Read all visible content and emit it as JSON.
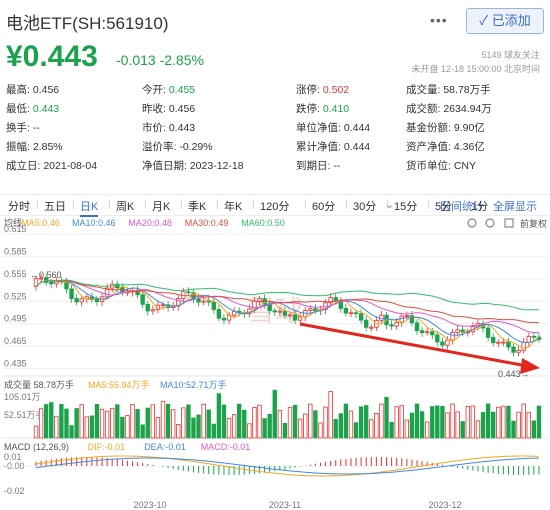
{
  "header": {
    "title": "电池ETF(SH:561910)",
    "more": "•••",
    "add_label": "✓ 已添加"
  },
  "quote": {
    "price": "¥0.443",
    "change": "-0.013",
    "change_pct": "-2.85%",
    "followers": "5149 球友关注",
    "status": "未开盘 12-18 15:00:00 北京时间"
  },
  "stats": [
    [
      {
        "label": "最高:",
        "value": "0.456",
        "tone": ""
      },
      {
        "label": "今开:",
        "value": "0.455",
        "tone": "down"
      },
      {
        "label": "涨停:",
        "value": "0.502",
        "tone": "up"
      },
      {
        "label": "成交量:",
        "value": "58.78万手",
        "tone": ""
      }
    ],
    [
      {
        "label": "最低:",
        "value": "0.443",
        "tone": "down"
      },
      {
        "label": "昨收:",
        "value": "0.456",
        "tone": ""
      },
      {
        "label": "跌停:",
        "value": "0.410",
        "tone": "down"
      },
      {
        "label": "成交额:",
        "value": "2634.94万",
        "tone": ""
      }
    ],
    [
      {
        "label": "换手:",
        "value": "--",
        "tone": ""
      },
      {
        "label": "市价:",
        "value": "0.443",
        "tone": ""
      },
      {
        "label": "单位净值:",
        "value": "0.444",
        "tone": ""
      },
      {
        "label": "基金份额:",
        "value": "9.90亿",
        "tone": ""
      }
    ],
    [
      {
        "label": "振幅:",
        "value": "2.85%",
        "tone": ""
      },
      {
        "label": "溢价率:",
        "value": "-0.29%",
        "tone": ""
      },
      {
        "label": "累计净值:",
        "value": "0.444",
        "tone": ""
      },
      {
        "label": "资产净值:",
        "value": "4.36亿",
        "tone": ""
      }
    ],
    [
      {
        "label": "成立日:",
        "value": "2021-08-04",
        "tone": ""
      },
      {
        "label": "净值日期:",
        "value": "2023-12-18",
        "tone": ""
      },
      {
        "label": "到期日:",
        "value": "--",
        "tone": ""
      },
      {
        "label": "货币单位:",
        "value": "CNY",
        "tone": ""
      }
    ]
  ],
  "tabs": [
    "分时",
    "五日",
    "日K",
    "周K",
    "月K",
    "季K",
    "年K",
    "120分",
    "60分",
    "30分",
    "15分",
    "5分",
    "1分"
  ],
  "active_tab": "日K",
  "chevron": "⌄",
  "links": {
    "stats": "区间统计",
    "fullscreen": "全屏显示"
  },
  "chart": {
    "legend": [
      {
        "text": "均线",
        "color": "#555555"
      },
      {
        "text": "MA5:0.46",
        "color": "#f5a623"
      },
      {
        "text": "MA10:0.46",
        "color": "#3d8be0"
      },
      {
        "text": "MA20:0.48",
        "color": "#e056c8"
      },
      {
        "text": "MA30:0.49",
        "color": "#e04c3f"
      },
      {
        "text": "MA60:0.50",
        "color": "#2fbf6a"
      }
    ],
    "icons": [
      "gear-icon",
      "settings-icon",
      "expand-icon"
    ],
    "fq": "前复权",
    "y_ticks": [
      "0.615",
      "0.585",
      "0.555",
      "0.525",
      "0.495",
      "0.465",
      "0.435"
    ],
    "high_label": "0.560",
    "last_label": "0.443",
    "vol_legend": [
      {
        "text": "成交量 58.78万手",
        "color": "#555555"
      },
      {
        "text": "MA5:55.94万手",
        "color": "#f5a623"
      },
      {
        "text": "MA10:52.71万手",
        "color": "#3d8be0"
      }
    ],
    "vol_ticks": [
      "105.01万",
      "52.51万手"
    ],
    "macd_legend": [
      {
        "text": "MACD (12,26,9)",
        "color": "#555555"
      },
      {
        "text": "DIF:-0.01",
        "color": "#f5a623"
      },
      {
        "text": "DEA:-0.01",
        "color": "#3d8be0"
      },
      {
        "text": "MACD:-0.01",
        "color": "#e056c8"
      }
    ],
    "macd_ticks": [
      "0.01",
      "-0.00",
      "-0.02"
    ],
    "x_labels": [
      "2023-10",
      "2023-11",
      "2023-12"
    ],
    "watermark": "雪球"
  },
  "colors": {
    "up": "#e33232",
    "down": "#1aa34a",
    "accent": "#3a6fcf"
  }
}
